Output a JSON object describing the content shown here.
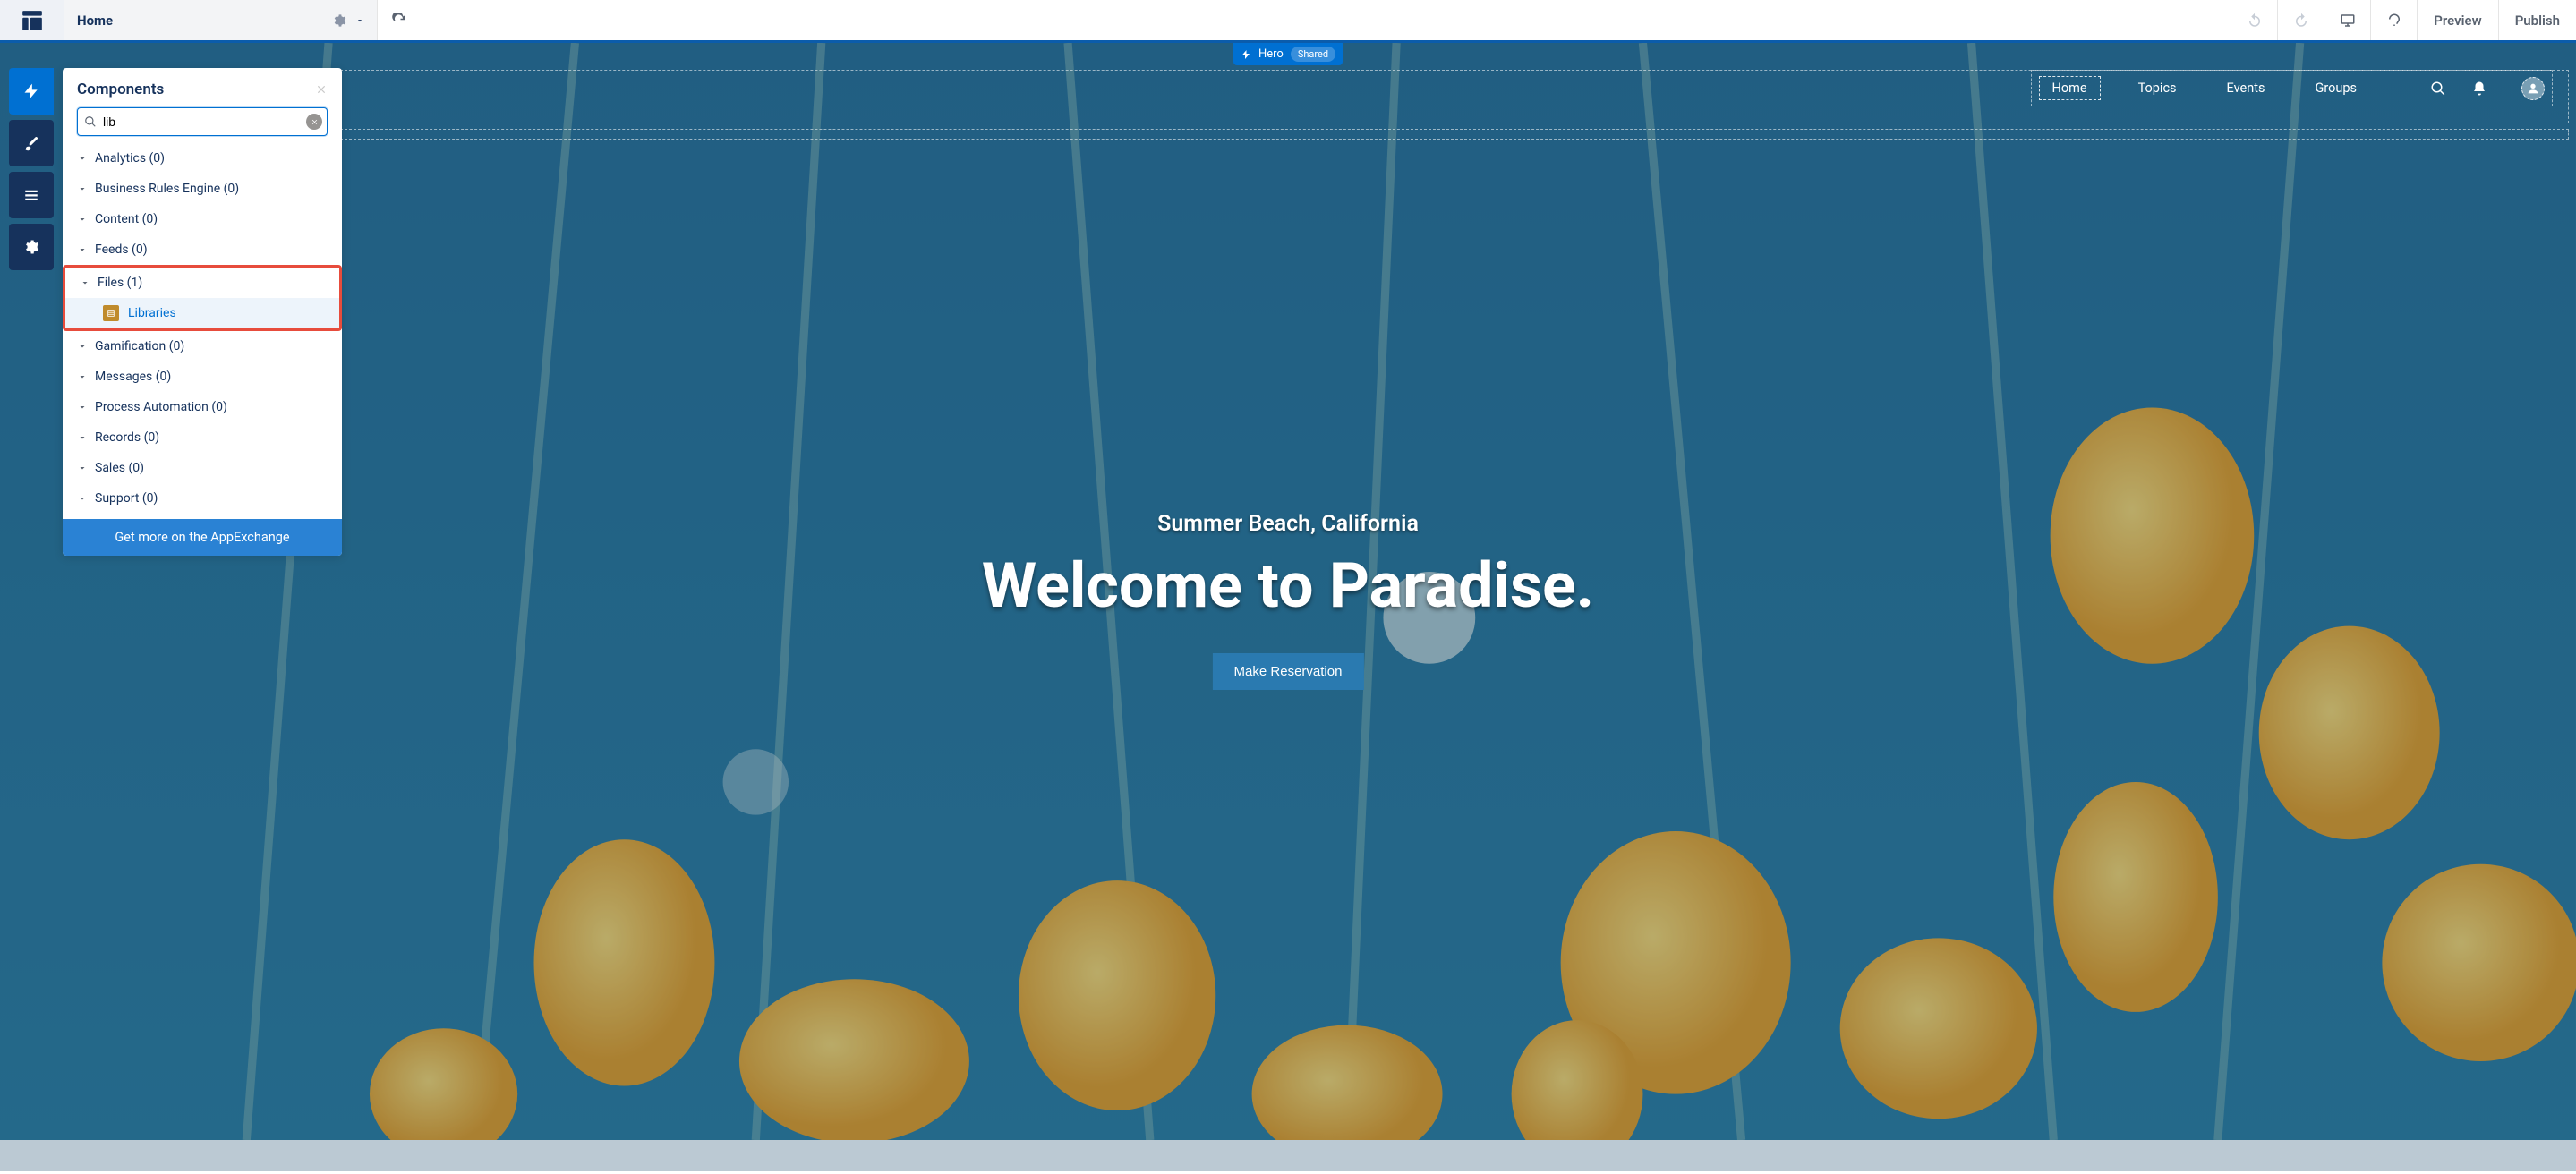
{
  "topbar": {
    "page_title": "Home",
    "preview_label": "Preview",
    "publish_label": "Publish"
  },
  "left_rail": {
    "items": [
      "components",
      "theme",
      "page-structure",
      "settings"
    ]
  },
  "components_panel": {
    "title": "Components",
    "search_value": "lib",
    "categories": [
      {
        "label": "Analytics (0)",
        "items": []
      },
      {
        "label": "Business Rules Engine (0)",
        "items": []
      },
      {
        "label": "Content (0)",
        "items": []
      },
      {
        "label": "Feeds (0)",
        "items": []
      },
      {
        "label": "Files (1)",
        "items": [
          "Libraries"
        ],
        "highlighted": true
      },
      {
        "label": "Gamification (0)",
        "items": []
      },
      {
        "label": "Messages (0)",
        "items": []
      },
      {
        "label": "Process Automation (0)",
        "items": []
      },
      {
        "label": "Records (0)",
        "items": []
      },
      {
        "label": "Sales (0)",
        "items": []
      },
      {
        "label": "Support (0)",
        "items": []
      }
    ],
    "footer_label": "Get more on the AppExchange"
  },
  "canvas": {
    "selected_component": {
      "name": "Hero",
      "badge": "Shared"
    },
    "nav_items": [
      "Home",
      "Topics",
      "Events",
      "Groups"
    ],
    "hero": {
      "subtitle": "Summer Beach, California",
      "title": "Welcome to Paradise.",
      "button_label": "Make Reservation"
    }
  },
  "colors": {
    "brand": "#0070d2",
    "dark": "#16325c",
    "highlight": "#e74c3c"
  }
}
